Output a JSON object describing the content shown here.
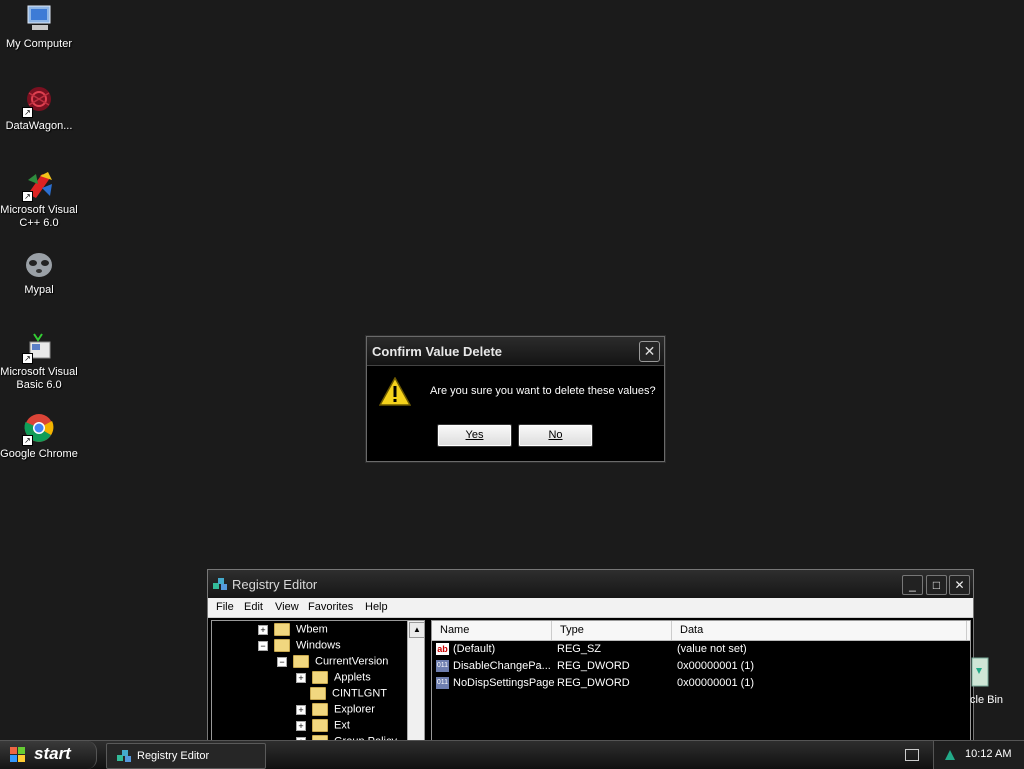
{
  "desktop": {
    "icons": [
      {
        "label": "My Computer",
        "icon": "my-computer-icon"
      },
      {
        "label": "DataWagon...",
        "icon": "datawagon-icon"
      },
      {
        "label": "Microsoft Visual C++ 6.0",
        "icon": "visual-cpp-icon"
      },
      {
        "label": "Mypal",
        "icon": "mypal-icon"
      },
      {
        "label": "Microsoft Visual Basic 6.0",
        "icon": "visual-basic-icon"
      },
      {
        "label": "Google Chrome",
        "icon": "chrome-icon"
      }
    ],
    "recycle_bin_label": "cle Bin"
  },
  "dialog": {
    "title": "Confirm Value Delete",
    "message": "Are you sure you want to delete these values?",
    "yes_label": "Yes",
    "no_label": "No",
    "close_glyph": "✕",
    "icon": "warning-icon"
  },
  "registry_editor": {
    "title": "Registry Editor",
    "menu": [
      "File",
      "Edit",
      "View",
      "Favorites",
      "Help"
    ],
    "tree": [
      {
        "label": "Wbem",
        "expander": "+"
      },
      {
        "label": "Windows",
        "expander": "−"
      },
      {
        "label": "CurrentVersion",
        "expander": "−"
      },
      {
        "label": "Applets",
        "expander": "+"
      },
      {
        "label": "CINTLGNT",
        "expander": ""
      },
      {
        "label": "Explorer",
        "expander": "+"
      },
      {
        "label": "Ext",
        "expander": "+"
      },
      {
        "label": "Group Policy",
        "expander": "+"
      }
    ],
    "columns": [
      "Name",
      "Type",
      "Data"
    ],
    "values": [
      {
        "name": "(Default)",
        "type": "REG_SZ",
        "data": "(value not set)",
        "icon": "string-value-icon"
      },
      {
        "name": "DisableChangePa...",
        "type": "REG_DWORD",
        "data": "0x00000001 (1)",
        "icon": "binary-value-icon"
      },
      {
        "name": "NoDispSettingsPage",
        "type": "REG_DWORD",
        "data": "0x00000001 (1)",
        "icon": "binary-value-icon"
      }
    ]
  },
  "taskbar": {
    "start_label": "start",
    "task_label": "Registry Editor",
    "clock": "10:12 AM"
  }
}
